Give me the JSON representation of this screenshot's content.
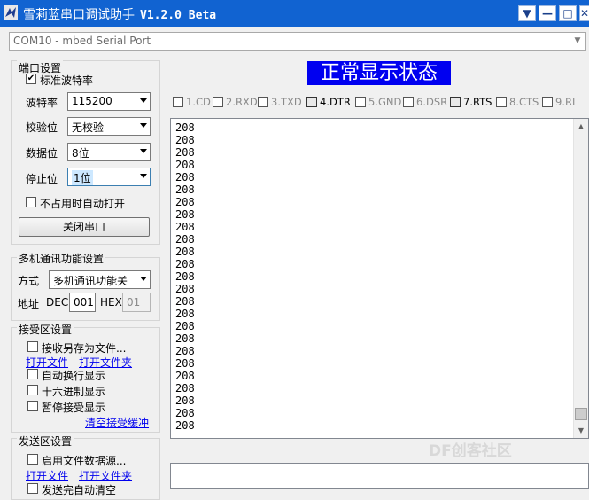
{
  "window": {
    "title": "雪莉蓝串口调试助手",
    "version": "V1.2.0 Beta",
    "controls": [
      "▼",
      "—",
      "□",
      "✕"
    ]
  },
  "port": {
    "selected": "COM10 - mbed Serial Port"
  },
  "port_settings": {
    "group_title": "端口设置",
    "std_baud_label": "标准波特率",
    "std_baud_checked": true,
    "baud_label": "波特率",
    "baud_value": "115200",
    "parity_label": "校验位",
    "parity_value": "无校验",
    "databits_label": "数据位",
    "databits_value": "8位",
    "stopbits_label": "停止位",
    "stopbits_value": "1位",
    "auto_open_label": "不占用时自动打开",
    "auto_open_checked": false,
    "close_button": "关闭串口"
  },
  "multi": {
    "group_title": "多机通讯功能设置",
    "mode_label": "方式",
    "mode_value": "多机通讯功能关",
    "addr_label": "地址",
    "dec_label": "DEC",
    "dec_value": "001",
    "hex_label": "HEX",
    "hex_value": "01"
  },
  "receive": {
    "group_title": "接受区设置",
    "save_as_label": "接收另存为文件...",
    "open_file": "打开文件",
    "open_folder": "打开文件夹",
    "auto_wrap": "自动换行显示",
    "hex_display": "十六进制显示",
    "pause": "暂停接受显示",
    "clear_buffer": "清空接受缓冲"
  },
  "send": {
    "group_title": "发送区设置",
    "file_source": "启用文件数据源...",
    "open_file": "打开文件",
    "open_folder": "打开文件夹",
    "auto_clear": "发送完自动清空"
  },
  "status": {
    "title": "正常显示状态",
    "pins": [
      {
        "label": "1.CD",
        "on": false
      },
      {
        "label": "2.RXD",
        "on": false
      },
      {
        "label": "3.TXD",
        "on": false
      },
      {
        "label": "4.DTR",
        "on": true
      },
      {
        "label": "5.GND",
        "on": false
      },
      {
        "label": "6.DSR",
        "on": false
      },
      {
        "label": "7.RTS",
        "on": true
      },
      {
        "label": "8.CTS",
        "on": false
      },
      {
        "label": "9.RI",
        "on": false
      }
    ]
  },
  "received_lines": [
    "208",
    "208",
    "208",
    "208",
    "208",
    "208",
    "208",
    "208",
    "208",
    "208",
    "208",
    "208",
    "208",
    "208",
    "208",
    "208",
    "208",
    "208",
    "208",
    "208",
    "208",
    "208",
    "208",
    "208",
    "208"
  ],
  "watermark": "DF创客社区",
  "colors": {
    "titlebar": "#1163d1",
    "status_bg": "#0000f0",
    "link": "#0000ee"
  }
}
